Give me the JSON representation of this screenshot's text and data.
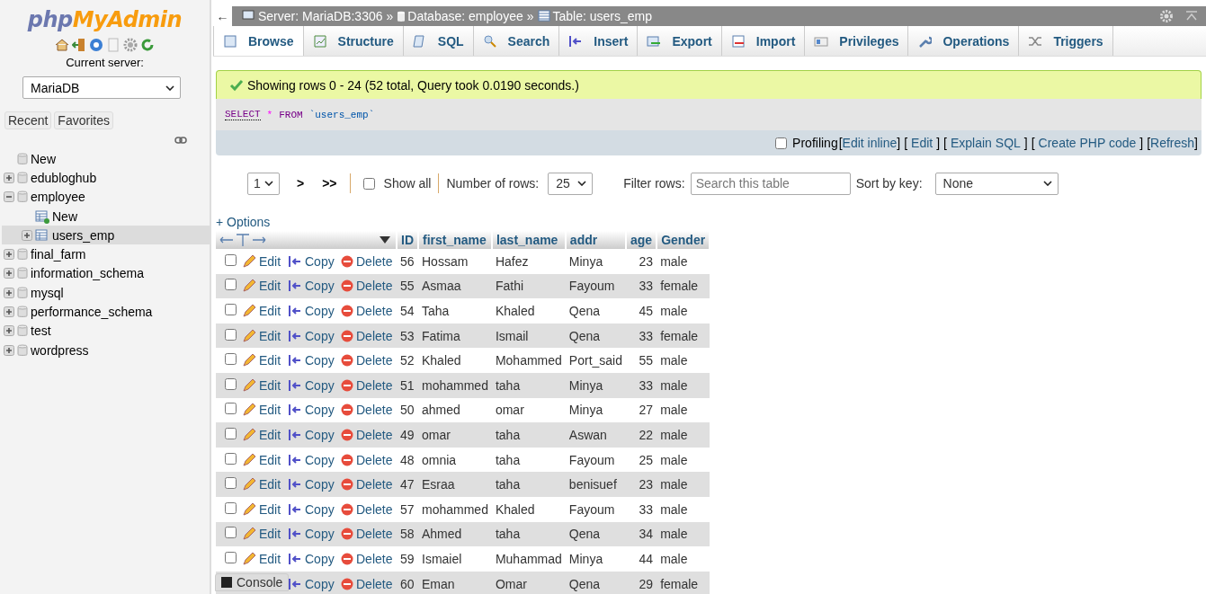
{
  "logo": {
    "part1": "php",
    "part2": "MyAdmin"
  },
  "sidebar": {
    "current_server_label": "Current server:",
    "server_select": "MariaDB",
    "buttons": [
      "Recent",
      "Favorites"
    ],
    "tree": [
      {
        "kind": "new",
        "label": "New",
        "selected": false
      },
      {
        "kind": "db",
        "label": "edubloghub",
        "expanded": false,
        "selected": false
      },
      {
        "kind": "db",
        "label": "employee",
        "expanded": true,
        "selected": false,
        "children": [
          {
            "kind": "new-table",
            "label": "New",
            "selected": false
          },
          {
            "kind": "table",
            "label": "users_emp",
            "expanded": false,
            "selected": true
          }
        ]
      },
      {
        "kind": "db",
        "label": "final_farm",
        "expanded": false,
        "selected": false
      },
      {
        "kind": "db",
        "label": "information_schema",
        "expanded": false,
        "selected": false
      },
      {
        "kind": "db",
        "label": "mysql",
        "expanded": false,
        "selected": false
      },
      {
        "kind": "db",
        "label": "performance_schema",
        "expanded": false,
        "selected": false
      },
      {
        "kind": "db",
        "label": "test",
        "expanded": false,
        "selected": false
      },
      {
        "kind": "db",
        "label": "wordpress",
        "expanded": false,
        "selected": false
      }
    ]
  },
  "breadcrumb": {
    "back": "←",
    "items": [
      {
        "kind": "server",
        "label": "Server: MariaDB:3306",
        "separator": "»"
      },
      {
        "kind": "database",
        "label": "Database: employee",
        "separator": "»"
      },
      {
        "kind": "table",
        "label": "Table: users_emp"
      }
    ]
  },
  "tabs": [
    {
      "kind": "browse",
      "label": "Browse",
      "selected": true
    },
    {
      "kind": "structure",
      "label": "Structure",
      "selected": false
    },
    {
      "kind": "sql",
      "label": "SQL",
      "selected": false
    },
    {
      "kind": "search",
      "label": "Search",
      "selected": false
    },
    {
      "kind": "insert",
      "label": "Insert",
      "selected": false
    },
    {
      "kind": "export",
      "label": "Export",
      "selected": false
    },
    {
      "kind": "import",
      "label": "Import",
      "selected": false
    },
    {
      "kind": "privileges",
      "label": "Privileges",
      "selected": false
    },
    {
      "kind": "operations",
      "label": "Operations",
      "selected": false
    },
    {
      "kind": "triggers",
      "label": "Triggers",
      "selected": false
    }
  ],
  "message": "Showing rows 0 - 24 (52 total, Query took 0.0190 seconds.)",
  "sql": [
    {
      "kind": "keyword",
      "text": "SELECT"
    },
    {
      "kind": "operator",
      "text": "*"
    },
    {
      "kind": "keyword",
      "text": "FROM"
    },
    {
      "kind": "identifier",
      "text": "`users_emp`"
    }
  ],
  "profiling": {
    "checked": false,
    "label": "Profiling",
    "links": [
      {
        "open": "[",
        "text": "Edit inline",
        "close": "]"
      },
      {
        "open": "[",
        "text": "Edit",
        "close": "]"
      },
      {
        "open": "[",
        "text": "Explain SQL",
        "close": "]"
      },
      {
        "open": "[",
        "text": "Create PHP code",
        "close": "]"
      },
      {
        "open": "[",
        "text": "Refresh",
        "close": "]"
      }
    ]
  },
  "pagination": {
    "page": "1",
    "next": ">",
    "last": ">>",
    "show_all": {
      "label": "Show all",
      "checked": false
    },
    "rows_label": "Number of rows:",
    "rows": "25",
    "filter_label": "Filter rows:",
    "filter_placeholder": "Search this table",
    "sort_label": "Sort by key:",
    "sort": "None"
  },
  "options": "+ Options",
  "table": {
    "columns": [
      "ID",
      "first_name",
      "last_name",
      "addr",
      "age",
      "Gender"
    ],
    "rows": [
      {
        "checked": false,
        "actions": [
          {
            "kind": "edit",
            "label": "Edit"
          },
          {
            "kind": "copy",
            "label": "Copy"
          },
          {
            "kind": "delete",
            "label": "Delete"
          }
        ],
        "cells": [
          "56",
          "Hossam",
          "Hafez",
          "Minya",
          "23",
          "male"
        ]
      },
      {
        "checked": false,
        "actions": [
          {
            "kind": "edit",
            "label": "Edit"
          },
          {
            "kind": "copy",
            "label": "Copy"
          },
          {
            "kind": "delete",
            "label": "Delete"
          }
        ],
        "cells": [
          "55",
          "Asmaa",
          "Fathi",
          "Fayoum",
          "33",
          "female"
        ]
      },
      {
        "checked": false,
        "actions": [
          {
            "kind": "edit",
            "label": "Edit"
          },
          {
            "kind": "copy",
            "label": "Copy"
          },
          {
            "kind": "delete",
            "label": "Delete"
          }
        ],
        "cells": [
          "54",
          "Taha",
          "Khaled",
          "Qena",
          "45",
          "male"
        ]
      },
      {
        "checked": false,
        "actions": [
          {
            "kind": "edit",
            "label": "Edit"
          },
          {
            "kind": "copy",
            "label": "Copy"
          },
          {
            "kind": "delete",
            "label": "Delete"
          }
        ],
        "cells": [
          "53",
          "Fatima",
          "Ismail",
          "Qena",
          "33",
          "female"
        ]
      },
      {
        "checked": false,
        "actions": [
          {
            "kind": "edit",
            "label": "Edit"
          },
          {
            "kind": "copy",
            "label": "Copy"
          },
          {
            "kind": "delete",
            "label": "Delete"
          }
        ],
        "cells": [
          "52",
          "Khaled",
          "Mohammed",
          "Port_said",
          "55",
          "male"
        ]
      },
      {
        "checked": false,
        "actions": [
          {
            "kind": "edit",
            "label": "Edit"
          },
          {
            "kind": "copy",
            "label": "Copy"
          },
          {
            "kind": "delete",
            "label": "Delete"
          }
        ],
        "cells": [
          "51",
          "mohammed",
          "taha",
          "Minya",
          "33",
          "male"
        ]
      },
      {
        "checked": false,
        "actions": [
          {
            "kind": "edit",
            "label": "Edit"
          },
          {
            "kind": "copy",
            "label": "Copy"
          },
          {
            "kind": "delete",
            "label": "Delete"
          }
        ],
        "cells": [
          "50",
          "ahmed",
          "omar",
          "Minya",
          "27",
          "male"
        ]
      },
      {
        "checked": false,
        "actions": [
          {
            "kind": "edit",
            "label": "Edit"
          },
          {
            "kind": "copy",
            "label": "Copy"
          },
          {
            "kind": "delete",
            "label": "Delete"
          }
        ],
        "cells": [
          "49",
          "omar",
          "taha",
          "Aswan",
          "22",
          "male"
        ]
      },
      {
        "checked": false,
        "actions": [
          {
            "kind": "edit",
            "label": "Edit"
          },
          {
            "kind": "copy",
            "label": "Copy"
          },
          {
            "kind": "delete",
            "label": "Delete"
          }
        ],
        "cells": [
          "48",
          "omnia",
          "taha",
          "Fayoum",
          "25",
          "male"
        ]
      },
      {
        "checked": false,
        "actions": [
          {
            "kind": "edit",
            "label": "Edit"
          },
          {
            "kind": "copy",
            "label": "Copy"
          },
          {
            "kind": "delete",
            "label": "Delete"
          }
        ],
        "cells": [
          "47",
          "Esraa",
          "taha",
          "benisuef",
          "23",
          "male"
        ]
      },
      {
        "checked": false,
        "actions": [
          {
            "kind": "edit",
            "label": "Edit"
          },
          {
            "kind": "copy",
            "label": "Copy"
          },
          {
            "kind": "delete",
            "label": "Delete"
          }
        ],
        "cells": [
          "57",
          "mohammed",
          "Khaled",
          "Fayoum",
          "33",
          "male"
        ]
      },
      {
        "checked": false,
        "actions": [
          {
            "kind": "edit",
            "label": "Edit"
          },
          {
            "kind": "copy",
            "label": "Copy"
          },
          {
            "kind": "delete",
            "label": "Delete"
          }
        ],
        "cells": [
          "58",
          "Ahmed",
          "taha",
          "Qena",
          "34",
          "male"
        ]
      },
      {
        "checked": false,
        "actions": [
          {
            "kind": "edit",
            "label": "Edit"
          },
          {
            "kind": "copy",
            "label": "Copy"
          },
          {
            "kind": "delete",
            "label": "Delete"
          }
        ],
        "cells": [
          "59",
          "Ismaiel",
          "Muhammad",
          "Minya",
          "44",
          "male"
        ]
      },
      {
        "actions": [
          {
            "kind": "copy",
            "label": "Copy"
          },
          {
            "kind": "delete",
            "label": "Delete"
          }
        ],
        "cells": [
          "60",
          "Eman",
          "Omar",
          "Qena",
          "29",
          "female"
        ]
      }
    ]
  },
  "console": "Console"
}
